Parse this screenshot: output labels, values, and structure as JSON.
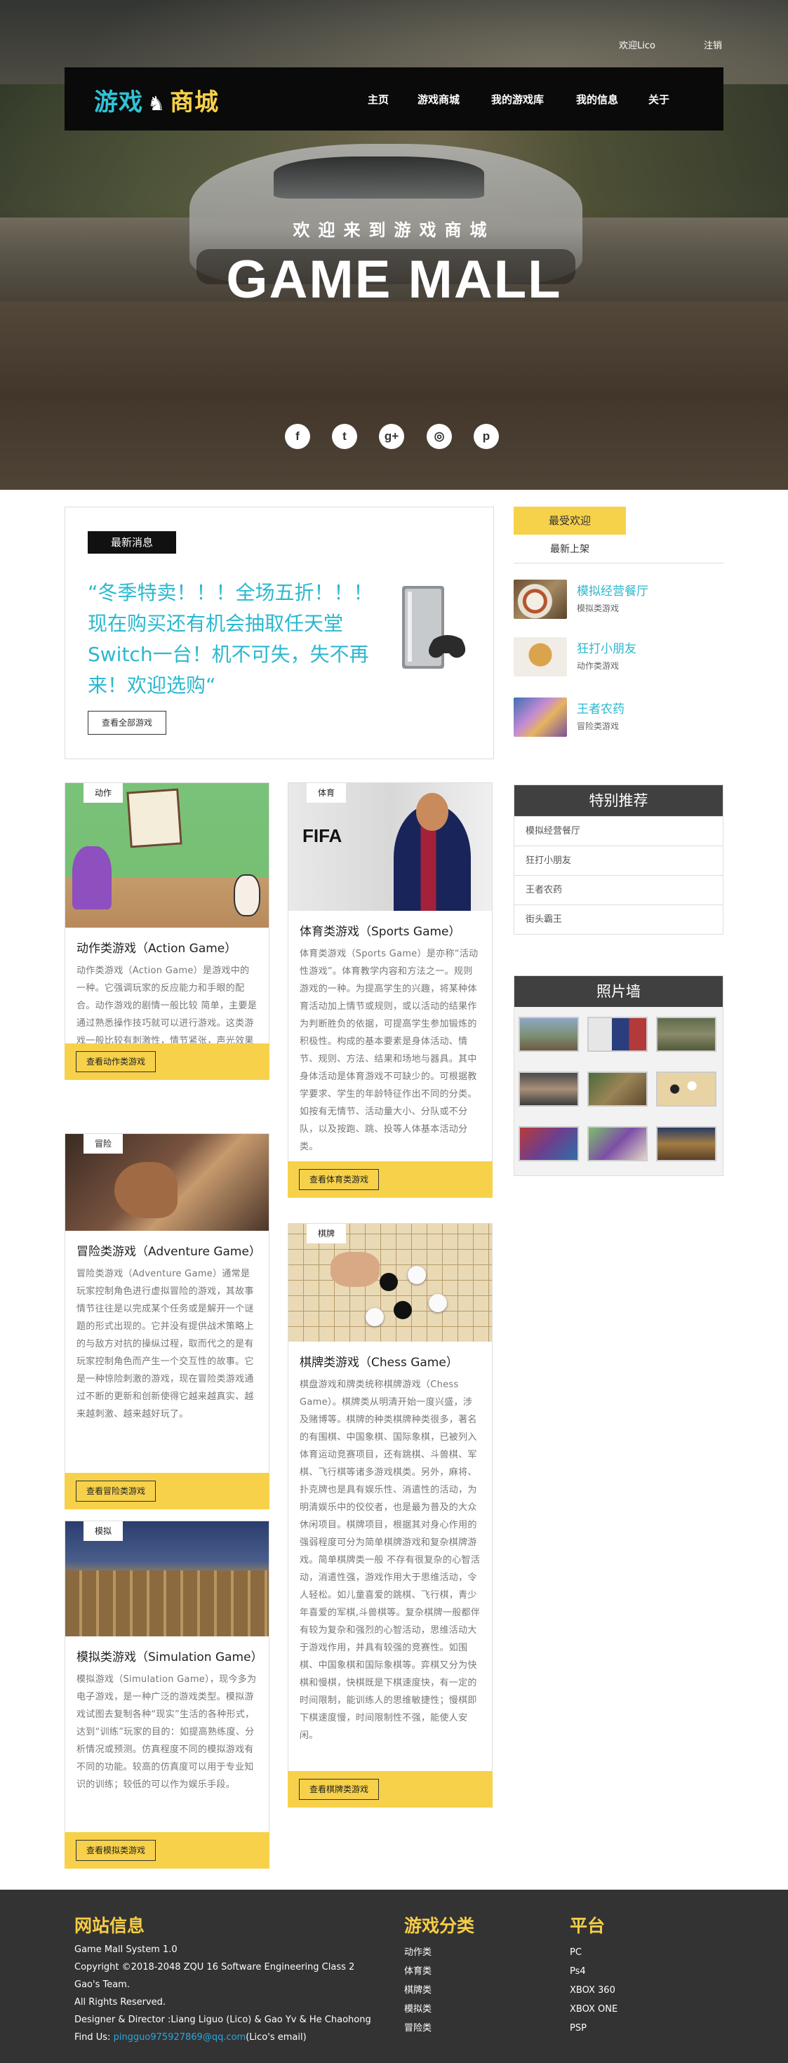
{
  "top_links": {
    "user": "欢迎Lico",
    "logout": "注销"
  },
  "logo": {
    "part1": "游戏",
    "part2": "商城",
    "icon": "chess-knight-icon"
  },
  "nav": [
    "主页",
    "游戏商城",
    "我的游戏库",
    "我的信息",
    "关于"
  ],
  "hero": {
    "welcome": "欢迎来到游戏商城",
    "title": "GAME MALL"
  },
  "social": [
    {
      "icon": "facebook-icon",
      "glyph": "f"
    },
    {
      "icon": "twitter-icon",
      "glyph": "t"
    },
    {
      "icon": "google-plus-icon",
      "glyph": "g+"
    },
    {
      "icon": "instagram-icon",
      "glyph": "◎"
    },
    {
      "icon": "pinterest-icon",
      "glyph": "p"
    }
  ],
  "news": {
    "label": "最新消息",
    "text": "“冬季特卖！！！全场五折！！！现在购买还有机会抽取任天堂Switch一台！机不可失，失不再来！欢迎选购“",
    "button": "查看全部游戏"
  },
  "favorites": {
    "tab": "最受欢迎",
    "sub": "最新上架",
    "items": [
      {
        "title": "模拟经营餐厅",
        "category": "模拟类游戏"
      },
      {
        "title": "狂打小朋友",
        "category": "动作类游戏"
      },
      {
        "title": "王者农药",
        "category": "冒险类游戏"
      }
    ]
  },
  "recommend": {
    "title": "特别推荐",
    "items": [
      "模拟经营餐厅",
      "狂打小朋友",
      "王者农药",
      "街头霸王"
    ]
  },
  "photowall": {
    "title": "照片墙"
  },
  "cards": [
    {
      "tag": "动作",
      "title": "动作类游戏（Action Game）",
      "desc": "动作类游戏（Action Game）是游戏中的一种。它强调玩家的反应能力和手眼的配合。动作游戏的剧情一般比较 简单，主要是通过熟悉操作技巧就可以进行游戏。这类游戏一般比较有刺激性，情节紧张，声光效果丰富，操作简单。",
      "button": "查看动作类游戏"
    },
    {
      "tag": "体育",
      "title": "体育类游戏（Sports Game）",
      "desc": "体育类游戏（Sports Game）是亦称“活动性游戏”。体育教学内容和方法之一。规则游戏的一种。为提高学生的兴趣，将某种体育活动加上情节或规则，或以活动的结果作为判断胜负的依据，可提高学生参加锻炼的积极性。构成的基本要素是身体活动、情节、规则、方法、结果和场地与器具。其中身体活动是体育游戏不可缺少的。可根据教学要求、学生的年龄特征作出不同的分类。如按有无情节、活动量大小、分队或不分队，以及按跑、跳、投等人体基本活动分类。",
      "button": "查看体育类游戏"
    },
    {
      "tag": "冒险",
      "title": "冒险类游戏（Adventure Game）",
      "desc": "冒险类游戏（Adventure Game）通常是玩家控制角色进行虚拟冒险的游戏，其故事情节往往是以完成某个任务或是解开一个谜题的形式出现的。它并没有提供战术策略上的与敌方对抗的操纵过程，取而代之的是有玩家控制角色而产生一个交互性的故事。它是一种惊险刺激的游戏，现在冒险类游戏通过不断的更新和创新使得它越来越真实、越来越刺激、越来越好玩了。",
      "button": "查看冒险类游戏"
    },
    {
      "tag": "棋牌",
      "title": "棋牌类游戏（Chess Game）",
      "desc": "棋盘游戏和牌类统称棋牌游戏（Chess Game）。棋牌类从明清开始一度兴盛，涉及赌博等。棋牌的种类棋牌种类很多，著名的有围棋、中国象棋、国际象棋，已被列入体育运动竞赛项目，还有跳棋、斗兽棋、军棋、飞行棋等诸多游戏棋类。另外，麻将、扑克牌也是具有娱乐性、消遣性的活动，为明清娱乐中的佼佼者，也是最为普及的大众休闲项目。棋牌项目，根据其对身心作用的强弱程度可分为简单棋牌游戏和复杂棋牌游戏。简单棋牌类一般 不存有很复杂的心智活动，消遣性强，游戏作用大于思维活动，令人轻松。如儿童喜爱的跳棋、飞行棋，青少年喜爱的军棋,斗兽棋等。复杂棋牌一般都伴有较为复杂和强烈的心智活动，思维活动大于游戏作用，并具有较强的竞赛性。如围棋、中国象棋和国际象棋等。弈棋又分为快棋和慢棋，快棋既是下棋速度快，有一定的时间限制，能训练人的思维敏捷性；慢棋即下棋速度慢，时间限制性不强，能使人安闲。",
      "button": "查看棋牌类游戏"
    },
    {
      "tag": "模拟",
      "title": "模拟类游戏（Simulation Game）",
      "desc": "模拟游戏（Simulation Game），现今多为电子游戏，是一种广泛的游戏类型。模拟游戏试图去复制各种“现实”生活的各种形式，达到“训练”玩家的目的：如提高熟练度、分析情况或预测。仿真程度不同的模拟游戏有不同的功能。较高的仿真度可以用于专业知识的训练；较低的可以作为娱乐手段。",
      "button": "查看模拟类游戏"
    }
  ],
  "footer": {
    "info": {
      "title": "网站信息",
      "lines": [
        "Game Mall System 1.0",
        "Copyright ©2018-2048 ZQU 16 Software Engineering Class 2",
        "Gao's Team.",
        "All Rights Reserved.",
        "Designer & Director :Liang Liguo (Lico) & Gao Yv & He Chaohong"
      ],
      "mail_label": "Find Us: ",
      "mail": "pingguo975927869@qq.com",
      "mail_note": "(Lico's email)"
    },
    "categories": {
      "title": "游戏分类",
      "items": [
        "动作类",
        "体育类",
        "棋牌类",
        "模拟类",
        "冒险类"
      ]
    },
    "platforms": {
      "title": "平台",
      "items": [
        "PC",
        "Ps4",
        "XBOX 360",
        "XBOX ONE",
        "PSP"
      ]
    }
  }
}
